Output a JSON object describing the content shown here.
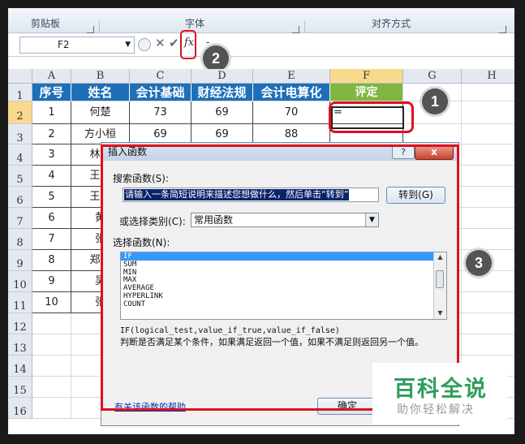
{
  "ribbon": {
    "groups": [
      "剪贴板",
      "字体",
      "对齐方式"
    ]
  },
  "formula_bar": {
    "name_box": "F2",
    "fx_label": "fx",
    "content": "-"
  },
  "columns": [
    "A",
    "B",
    "C",
    "D",
    "E",
    "F",
    "G",
    "H"
  ],
  "rows": [
    "1",
    "2",
    "3",
    "4",
    "5",
    "6",
    "7",
    "8",
    "9",
    "10",
    "11",
    "12",
    "13",
    "14",
    "15",
    "16"
  ],
  "table": {
    "headers": [
      "序号",
      "姓名",
      "会计基础",
      "财经法规",
      "会计电算化",
      "评定"
    ],
    "data": [
      [
        "1",
        "何楚",
        "73",
        "69",
        "70",
        "="
      ],
      [
        "2",
        "方小桓",
        "69",
        "69",
        "88",
        ""
      ],
      [
        "3",
        "林苏",
        "",
        "",
        "",
        ""
      ],
      [
        "4",
        "王才",
        "",
        "",
        "",
        ""
      ],
      [
        "5",
        "王文",
        "",
        "",
        "",
        ""
      ],
      [
        "6",
        "黄",
        "",
        "",
        "",
        ""
      ],
      [
        "7",
        "张",
        "",
        "",
        "",
        ""
      ],
      [
        "8",
        "郑小",
        "",
        "",
        "",
        ""
      ],
      [
        "9",
        "吴",
        "",
        "",
        "",
        ""
      ],
      [
        "10",
        "张",
        "",
        "",
        "",
        ""
      ]
    ]
  },
  "badges": [
    "1",
    "2",
    "3"
  ],
  "dialog": {
    "title": "插入函数",
    "help_btn": "?",
    "close_btn": "x",
    "search_label": "搜索函数(S):",
    "search_value": "请输入一条简短说明来描述您想做什么，然后单击“转到”",
    "go_button": "转到(G)",
    "category_label": "或选择类别(C):",
    "category_value": "常用函数",
    "select_label": "选择函数(N):",
    "functions": [
      "IF",
      "SUM",
      "MIN",
      "MAX",
      "AVERAGE",
      "HYPERLINK",
      "COUNT"
    ],
    "syntax": "IF(logical_test,value_if_true,value_if_false)",
    "description": "判断是否满足某个条件，如果满足返回一个值，如果不满足则返回另一个值。",
    "help_link": "有关该函数的帮助",
    "ok_button": "确定"
  },
  "watermark": {
    "title": "百科全说",
    "subtitle": "助你轻松解决"
  }
}
